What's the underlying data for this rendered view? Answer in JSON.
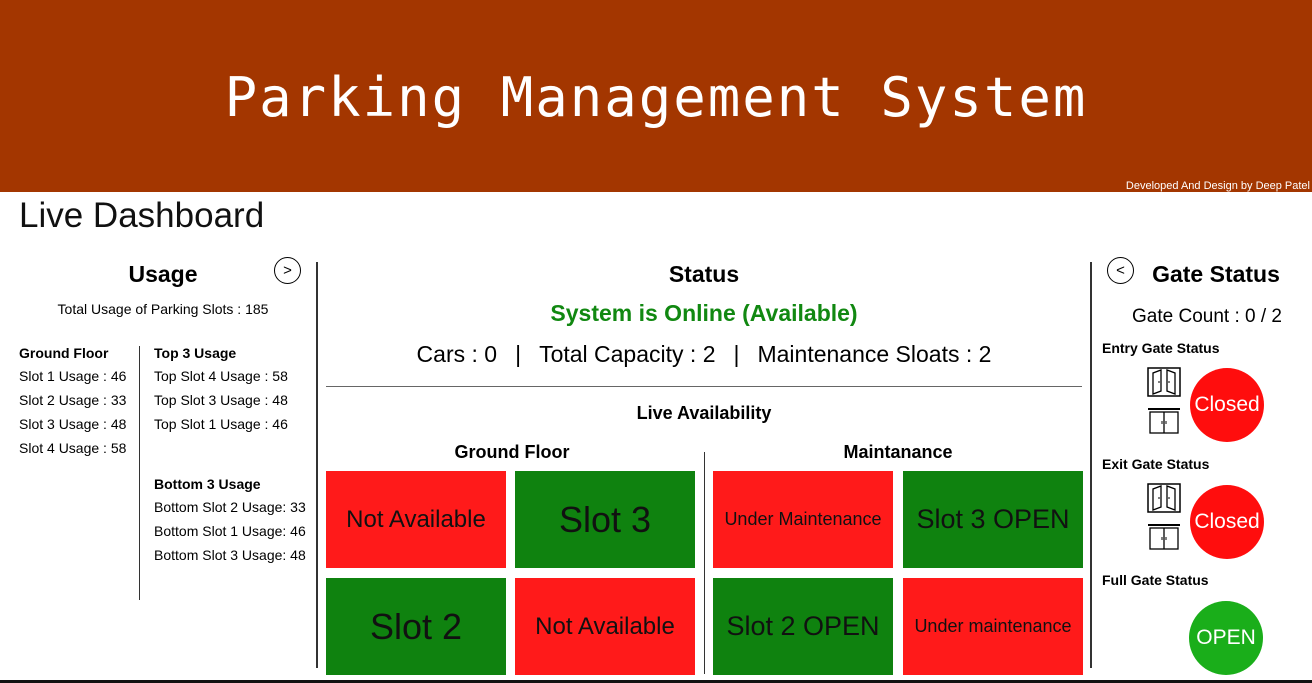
{
  "theme": {
    "header_color": "#a33600",
    "online_color": "#118811",
    "tile_red": "#ff1a1a",
    "tile_green": "#0f820f",
    "lamp_red": "#ff0d0d",
    "lamp_green": "#1aae1a"
  },
  "header": {
    "title": "Parking Management System",
    "credit": "Developed And Design by Deep Patel"
  },
  "page_title": "Live Dashboard",
  "usage": {
    "title": "Usage",
    "next_button_icon": "chevron-right-icon",
    "total": "Total Usage of Parking Slots : 185",
    "ground_floor": {
      "title": "Ground Floor",
      "items": [
        "Slot 1 Usage : 46",
        "Slot 2 Usage : 33",
        "Slot 3 Usage : 48",
        "Slot 4 Usage : 58"
      ]
    },
    "top3": {
      "title": "Top 3 Usage",
      "items": [
        "Top Slot 4 Usage : 58",
        "Top Slot 3 Usage : 48",
        "Top Slot 1 Usage : 46"
      ]
    },
    "bottom3": {
      "title": "Bottom 3 Usage",
      "items": [
        "Bottom Slot 2 Usage: 33",
        "Bottom Slot 1 Usage: 46",
        "Bottom Slot 3 Usage: 48"
      ]
    }
  },
  "status": {
    "title": "Status",
    "online": "System is Online (Available)",
    "cars": "Cars : 0",
    "capacity": "Total Capacity : 2",
    "maintenance": "Maintenance Sloats : 2",
    "separator": "|",
    "live_title": "Live Availability",
    "ground_floor": {
      "title": "Ground Floor",
      "tiles": [
        {
          "label": "Not Available",
          "state": "red"
        },
        {
          "label": "Slot 3",
          "state": "green"
        },
        {
          "label": "Slot 2",
          "state": "green"
        },
        {
          "label": "Not Available",
          "state": "red"
        }
      ]
    },
    "maintenance_section": {
      "title": "Maintanance",
      "tiles": [
        {
          "label": "Under Maintenance",
          "state": "red"
        },
        {
          "label": "Slot 3 OPEN",
          "state": "green"
        },
        {
          "label": "Slot 2 OPEN",
          "state": "green"
        },
        {
          "label": "Under maintenance",
          "state": "red"
        }
      ]
    }
  },
  "gate": {
    "title": "Gate Status",
    "back_button_icon": "chevron-left-icon",
    "count": "Gate Count : 0 / 2",
    "entry": {
      "label": "Entry Gate Status",
      "state": "Closed",
      "color": "red"
    },
    "exit": {
      "label": "Exit Gate Status",
      "state": "Closed",
      "color": "red"
    },
    "full": {
      "label": "Full Gate Status",
      "state": "OPEN",
      "color": "green"
    }
  }
}
